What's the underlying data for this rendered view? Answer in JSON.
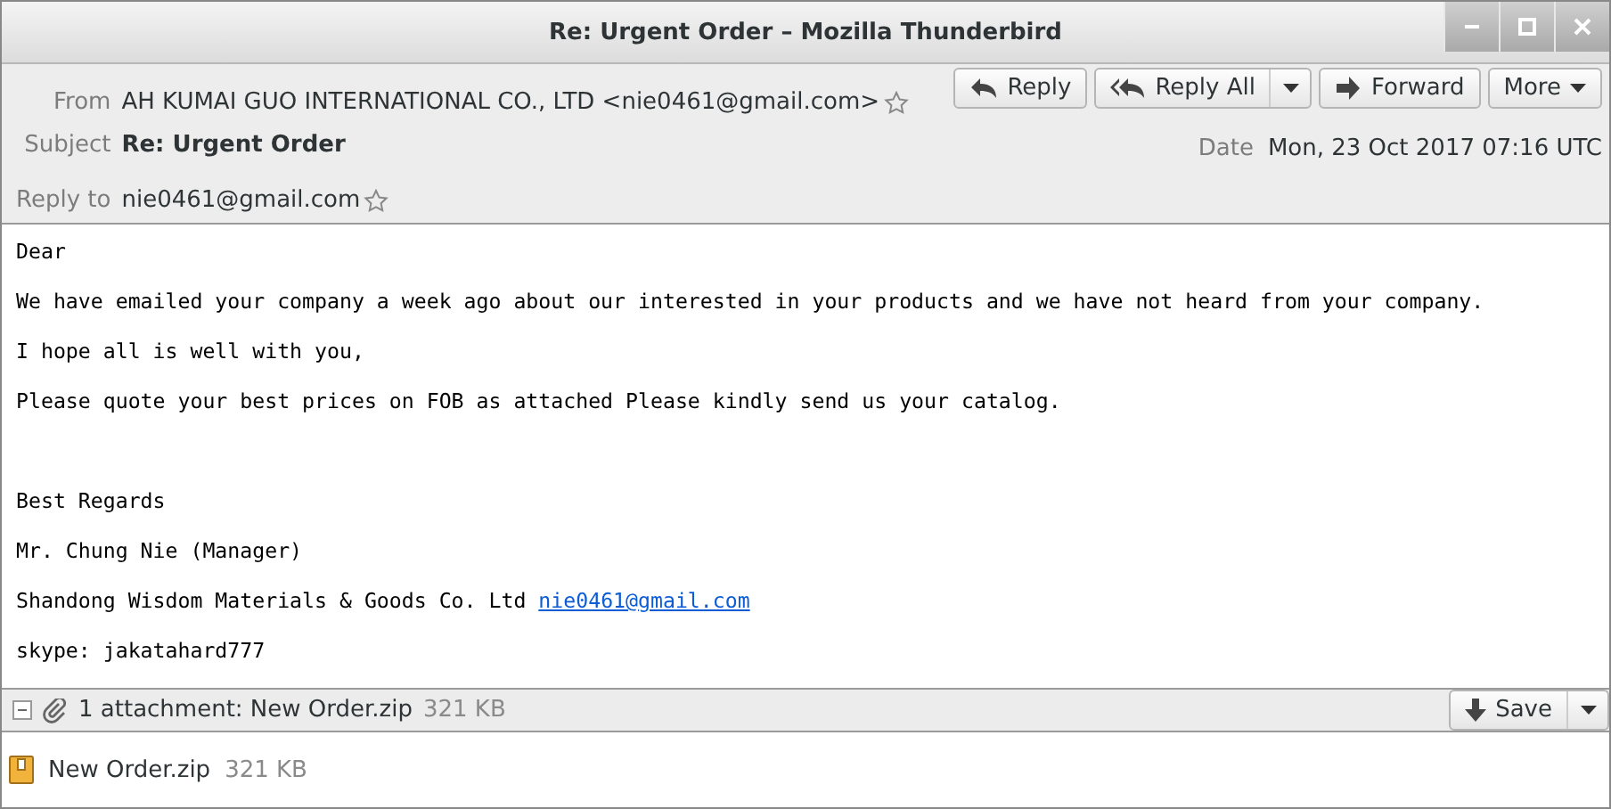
{
  "window": {
    "title": "Re: Urgent Order – Mozilla Thunderbird"
  },
  "header": {
    "from_label": "From",
    "from": "AH KUMAI GUO INTERNATIONAL CO., LTD <nie0461@gmail.com>",
    "subject_label": "Subject",
    "subject": "Re: Urgent Order",
    "reply_to_label": "Reply to",
    "reply_to": "nie0461@gmail.com",
    "date_label": "Date",
    "date": "Mon, 23 Oct 2017 07:16 UTC"
  },
  "buttons": [
    {
      "label": "Reply",
      "kind": "reply"
    },
    {
      "label": "Reply All",
      "kind": "reply-all"
    },
    {
      "label": "Forward",
      "kind": "forward"
    },
    {
      "label": "More",
      "kind": "more"
    }
  ],
  "body": [
    {
      "lines": [
        {
          "text": "Dear"
        },
        {
          "text": "We have emailed your company a week ago about our interested in your products and we have not heard from your company."
        },
        {
          "text": "I hope all is well with you,"
        },
        {
          "text": "Please quote your best prices on FOB as attached Please kindly send us your catalog."
        }
      ]
    },
    {
      "lines": [
        {
          "text": "Best Regards"
        },
        {
          "text": "Mr. Chung Nie (Manager)"
        },
        {
          "text": "Shandong Wisdom Materials & Goods Co. Ltd ",
          "link": "nie0461@gmail.com"
        },
        {
          "text": "skype: jakatahard777"
        }
      ]
    }
  ],
  "attachments": {
    "summary": "1 attachment: New Order.zip",
    "size": "321 KB",
    "save": "Save",
    "expanded": true,
    "items": [
      {
        "name": "New Order.zip",
        "size": "321 KB"
      }
    ]
  }
}
